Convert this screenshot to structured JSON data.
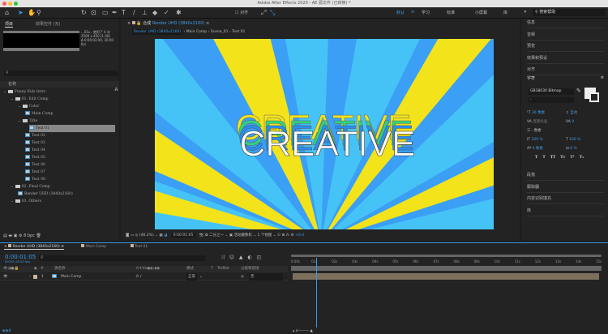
{
  "window": {
    "title": "Adobe After Effects 2020 - AE 源文件 (已转换) *"
  },
  "toolbar": {
    "align_label": "对齐",
    "workspaces": [
      "默认",
      "学习",
      "标准",
      "小屏幕",
      "库"
    ],
    "active_workspace": "默认",
    "search_placeholder": "搜索帮助",
    "more": "»"
  },
  "project_panel": {
    "tabs": [
      "项目",
      "效果控件 (无)"
    ],
    "preview_info": [
      "...01▾ , 使用了 4 次",
      "2500 x 450 (1.00)",
      "Δ 0:00:03:00, 30.00 fps"
    ],
    "column_name": "名称",
    "tree": [
      {
        "label": "Funny Kids Intro",
        "type": "folder",
        "depth": 0
      },
      {
        "label": "01. Edit Comp",
        "type": "folder",
        "depth": 1
      },
      {
        "label": "Color",
        "type": "folder",
        "depth": 2
      },
      {
        "label": "Main Comp",
        "type": "comp",
        "depth": 3
      },
      {
        "label": "Title",
        "type": "folder",
        "depth": 2
      },
      {
        "label": "Text 01",
        "type": "comp",
        "depth": 3,
        "selected": true
      },
      {
        "label": "Text 02",
        "type": "comp",
        "depth": 3
      },
      {
        "label": "Text 03",
        "type": "comp",
        "depth": 3
      },
      {
        "label": "Text 04",
        "type": "comp",
        "depth": 3
      },
      {
        "label": "Text 05",
        "type": "comp",
        "depth": 3
      },
      {
        "label": "Text 06",
        "type": "comp",
        "depth": 3
      },
      {
        "label": "Text 07",
        "type": "comp",
        "depth": 3
      },
      {
        "label": "Text 08",
        "type": "comp",
        "depth": 3
      },
      {
        "label": "02. Final Comp",
        "type": "folder",
        "depth": 1
      },
      {
        "label": "Render UHD (3840x2160)",
        "type": "comp",
        "depth": 2
      },
      {
        "label": "03. Others",
        "type": "folder",
        "depth": 1
      }
    ],
    "bpc": "8 bpc"
  },
  "comp_panel": {
    "tab_prefix": "合成",
    "tab_name": "Render UHD (3840x2160)",
    "breadcrumbs": [
      "Render UHD (3840x2160)",
      "Main Comp",
      "Scene_01",
      "Text 01"
    ],
    "canvas_text": "CREATIVE",
    "zoom": "(46.2%)",
    "timecode": "0:00:01:05",
    "resolution": "二分之一",
    "camera": "活动摄像机",
    "views": "1 个视图",
    "exposure": "+0.0",
    "colors": {
      "bg": "#3a9ff5",
      "light": "#46c3f6",
      "yellow": "#f3e31b",
      "green": "#2fd67a"
    }
  },
  "right_panel": {
    "sections_top": [
      "信息",
      "音频",
      "预览",
      "效果和预设",
      "对齐"
    ],
    "character": {
      "title": "字符",
      "font": "GB18030 Bitmap",
      "style": "-",
      "size": "36 像素",
      "leading": "自动",
      "tracking_label": "度量标准",
      "tracking": "0",
      "stroke": "- 像素",
      "vscale": "100 %",
      "hscale": "100 %",
      "baseline": "0 像素",
      "tsume": "0 %",
      "styles": [
        "T",
        "T",
        "TT",
        "Tт",
        "T¹",
        "T₁"
      ]
    },
    "sections_bottom": [
      "段落",
      "跟踪器",
      "内容识别填充",
      "库"
    ]
  },
  "timeline": {
    "tabs": [
      "Render UHD (3840x2160)",
      "Main Comp",
      "Text 01"
    ],
    "timecode": "0:00:01:05",
    "fps": "00035 (30.00 fps)",
    "columns": {
      "source": "源名称",
      "mode": "模式",
      "t": "T",
      "trkmat": "TrkMat",
      "parent": "父级和链接",
      "num": "#"
    },
    "layers": [
      {
        "num": "1",
        "name": "Main Comp",
        "mode": "正常",
        "parent": "无"
      }
    ],
    "ruler": [
      "0:00s",
      "01s",
      "02s",
      "03s",
      "04s",
      "05s",
      "06s",
      "07s",
      "08s",
      "09s",
      "10s",
      "11s",
      "12s",
      "13s",
      "14s",
      "15s"
    ],
    "playhead_seconds": 1.17,
    "accent": "#3d9be8"
  }
}
